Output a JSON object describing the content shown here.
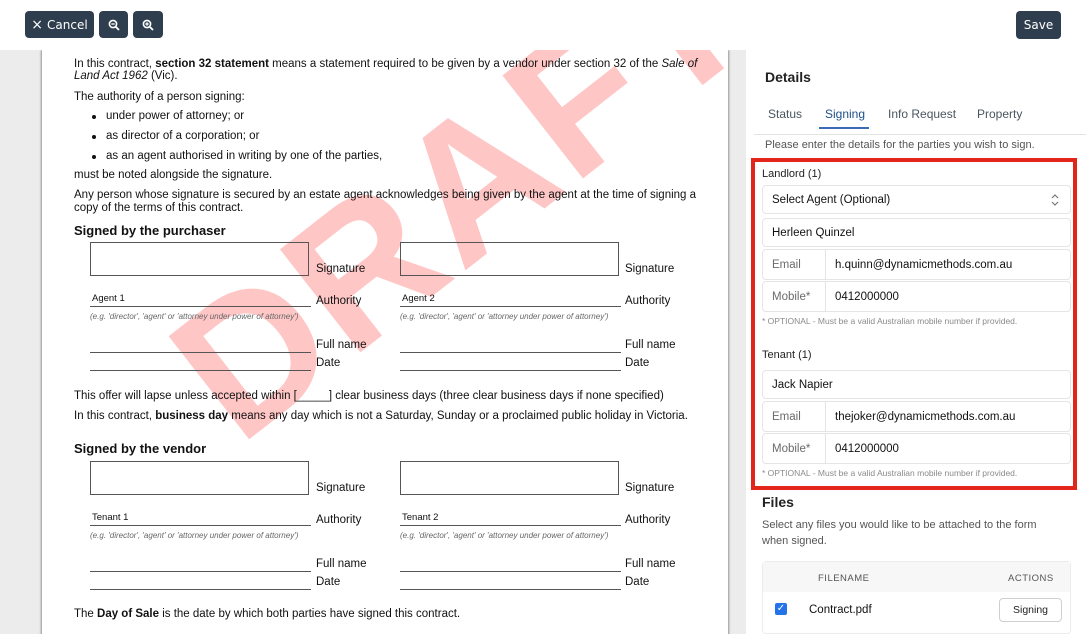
{
  "toolbar": {
    "cancel_label": "Cancel",
    "cancel_icon": "×",
    "zoom_out_icon": "zoom-out-icon",
    "zoom_in_icon": "zoom-in-icon",
    "save_label": "Save"
  },
  "document": {
    "watermark": "DRAFT",
    "para1_pre": "In this contract, ",
    "para1_bold": "section 32 statement",
    "para1_post": " means a statement required to be given by a vendor under section 32 of the ",
    "para1_ital": "Sale of",
    "para1_line2_ital": "Land Act 1962",
    "para1_line2_post": " (Vic).",
    "para2": "The authority of a person signing:",
    "bullets": [
      "under power of attorney; or",
      "as director of a corporation; or",
      "as an agent authorised in writing by one of the parties,"
    ],
    "para3": "must be noted alongside the signature.",
    "para4_line1": "Any person whose signature is secured by an estate agent acknowledges being given by the agent at the time of signing a",
    "para4_line2": "copy of the terms of this contract.",
    "purchaser_heading": "Signed by the purchaser",
    "vendor_heading": "Signed by the vendor",
    "label_signature": "Signature",
    "label_authority": "Authority",
    "label_fullname": "Full name",
    "label_date": "Date",
    "authority_hint": "(e.g. 'director', 'agent' or 'attorney under power of attorney')",
    "purchaser_agents": [
      "Agent 1",
      "Agent 2"
    ],
    "vendor_tenants": [
      "Tenant 1",
      "Tenant 2"
    ],
    "lapse_text": "This offer will lapse unless accepted within [_____] clear business days (three clear business days if none specified)",
    "bday_pre": "In this contract, ",
    "bday_bold": "business day",
    "bday_post": " means any day which is not a Saturday, Sunday or a proclaimed public holiday in Victoria.",
    "dos_pre": "The ",
    "dos_bold": "Day of Sale",
    "dos_post": " is the date by which both parties have signed this contract."
  },
  "details": {
    "title": "Details",
    "tabs": [
      "Status",
      "Signing",
      "Info Request",
      "Property"
    ],
    "active_tab": "Signing",
    "instruction": "Please enter the details for the parties you wish to sign.",
    "landlord": {
      "heading": "Landlord (1)",
      "agent_select": "Select Agent (Optional)",
      "name": "Herleen Quinzel",
      "email_label": "Email",
      "email": "h.quinn@dynamicmethods.com.au",
      "mobile_label": "Mobile*",
      "mobile": "0412000000",
      "note": "* OPTIONAL - Must be a valid Australian mobile number if provided."
    },
    "tenant": {
      "heading": "Tenant (1)",
      "name": "Jack Napier",
      "email_label": "Email",
      "email": "thejoker@dynamicmethods.com.au",
      "mobile_label": "Mobile*",
      "mobile": "0412000000",
      "note": "* OPTIONAL - Must be a valid Australian mobile number if provided."
    },
    "files": {
      "heading": "Files",
      "description_line1": "Select any files you would like to be attached to the form",
      "description_line2": "when signed.",
      "col_filename": "FILENAME",
      "col_actions": "ACTIONS",
      "rows": [
        {
          "filename": "Contract.pdf",
          "checked": true,
          "action": "Signing"
        }
      ]
    }
  },
  "colors": {
    "toolbar_button": "#2f3e4e",
    "highlight_border": "#e1251b",
    "active_tab": "#1d4f8c",
    "checkbox": "#2573e8",
    "watermark": "#ff7878"
  }
}
